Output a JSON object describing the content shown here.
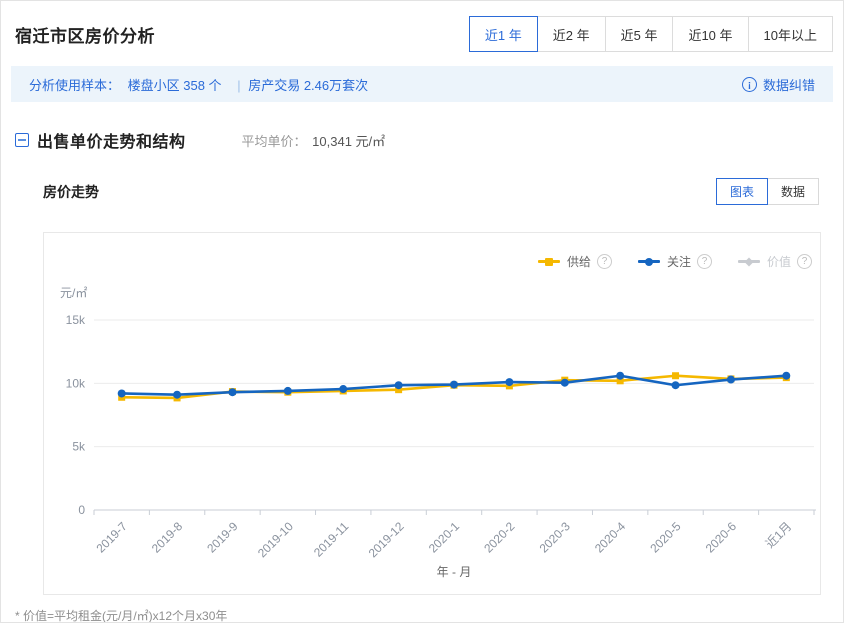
{
  "page": {
    "title": "宿迁市区房价分析"
  },
  "time_tabs": {
    "items": [
      {
        "label": "近1 年",
        "active": true
      },
      {
        "label": "近2 年",
        "active": false
      },
      {
        "label": "近5 年",
        "active": false
      },
      {
        "label": "近10 年",
        "active": false
      },
      {
        "label": "10年以上",
        "active": false
      }
    ]
  },
  "sample_bar": {
    "label": "分析使用样本：",
    "sample_buildings": "楼盘小区 358 个",
    "divider": "|",
    "sample_deals": "房产交易 2.46万套次",
    "correction_label": "数据纠错",
    "info_glyph": "!"
  },
  "section": {
    "title": "出售单价走势和结构",
    "avg_label": "平均单价：",
    "avg_value": "10,341 元/㎡"
  },
  "chart_header": {
    "title": "房价走势",
    "toggle": [
      {
        "label": "图表",
        "active": true
      },
      {
        "label": "数据",
        "active": false
      }
    ]
  },
  "ui": {
    "help_glyph": "?"
  },
  "footnote": "* 价值=平均租金(元/月/㎡)x12个月x30年",
  "chart_data": {
    "type": "line",
    "unit": "元/㎡",
    "xlabel": "年 - 月",
    "categories": [
      "2019-7",
      "2019-8",
      "2019-9",
      "2019-10",
      "2019-11",
      "2019-12",
      "2020-1",
      "2020-2",
      "2020-3",
      "2020-4",
      "2020-5",
      "2020-6",
      "近1月"
    ],
    "ylim": [
      0,
      15000
    ],
    "yticks": [
      {
        "value": 0,
        "label": "0"
      },
      {
        "value": 5000,
        "label": "5k"
      },
      {
        "value": 10000,
        "label": "10k"
      },
      {
        "value": 15000,
        "label": "15k"
      }
    ],
    "grid": true,
    "legend_position": "top-right",
    "series": [
      {
        "name": "供给",
        "color": "#f5b800",
        "marker": "square",
        "disabled": false,
        "values": [
          8900,
          8850,
          9350,
          9300,
          9400,
          9500,
          9850,
          9800,
          10250,
          10200,
          10600,
          10350,
          10450
        ]
      },
      {
        "name": "关注",
        "color": "#1565c0",
        "marker": "circle",
        "disabled": false,
        "values": [
          9200,
          9100,
          9300,
          9400,
          9550,
          9850,
          9900,
          10100,
          10050,
          10600,
          9850,
          10300,
          10600
        ]
      },
      {
        "name": "价值",
        "color": "#c8cbd0",
        "marker": "diamond",
        "disabled": true,
        "values": []
      }
    ],
    "axis_colors": {
      "axis_line": "#c9ced6",
      "grid_line": "#ebebeb",
      "tick_label": "#8a929e",
      "axis_name": "#666666"
    }
  }
}
